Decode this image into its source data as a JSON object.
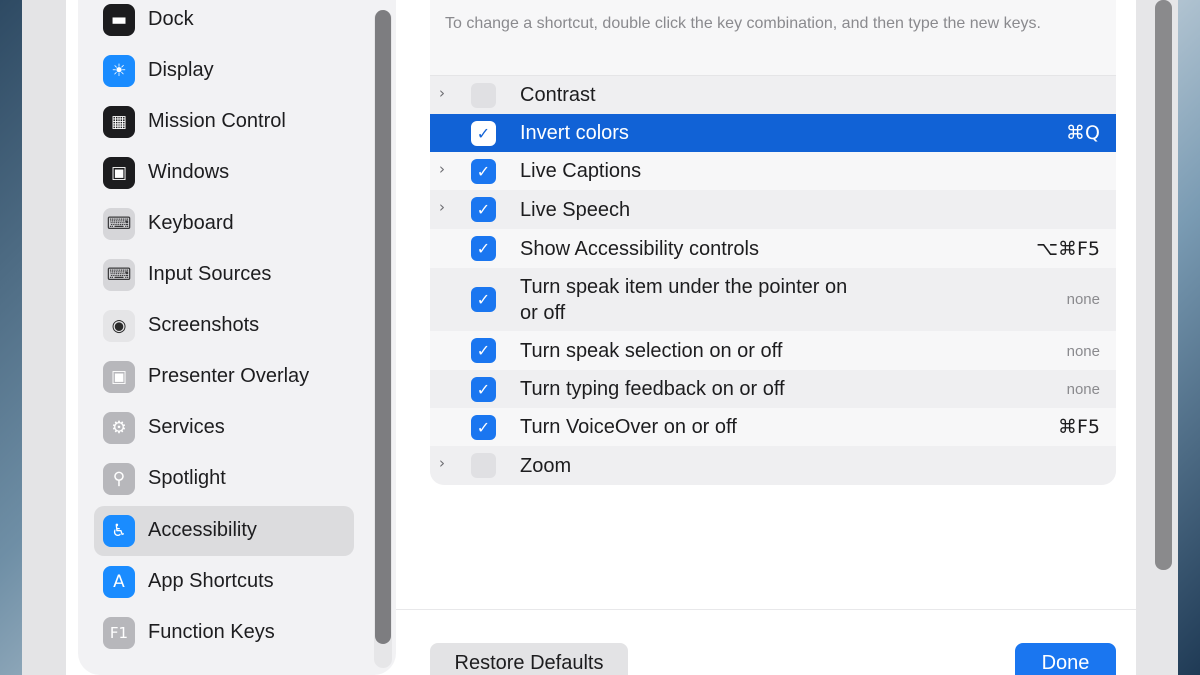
{
  "sidebar": {
    "items": [
      {
        "label": "Dock",
        "icon": "dock-icon",
        "glyph": "▬"
      },
      {
        "label": "Display",
        "icon": "sun-icon",
        "glyph": "☀"
      },
      {
        "label": "Mission Control",
        "icon": "mission-control-icon",
        "glyph": "▦"
      },
      {
        "label": "Windows",
        "icon": "windows-icon",
        "glyph": "▣"
      },
      {
        "label": "Keyboard",
        "icon": "keyboard-icon",
        "glyph": "⌨"
      },
      {
        "label": "Input Sources",
        "icon": "input-sources-icon",
        "glyph": "⌨"
      },
      {
        "label": "Screenshots",
        "icon": "camera-icon",
        "glyph": "◉"
      },
      {
        "label": "Presenter Overlay",
        "icon": "presenter-overlay-icon",
        "glyph": "▣"
      },
      {
        "label": "Services",
        "icon": "gears-icon",
        "glyph": "⚙"
      },
      {
        "label": "Spotlight",
        "icon": "magnifier-icon",
        "glyph": "⚲"
      },
      {
        "label": "Accessibility",
        "icon": "accessibility-icon",
        "glyph": "♿"
      },
      {
        "label": "App Shortcuts",
        "icon": "app-store-icon",
        "glyph": "A"
      },
      {
        "label": "Function Keys",
        "icon": "function-keys-icon",
        "glyph": "F1"
      }
    ],
    "selected": "Accessibility"
  },
  "main": {
    "description": "To change a shortcut, double click the key combination, and then type the new keys.",
    "rows": [
      {
        "label": "Contrast",
        "expandable": true,
        "checked": false,
        "key": ""
      },
      {
        "label": "Invert colors",
        "expandable": false,
        "checked": true,
        "key": "⌘Q",
        "selected": true
      },
      {
        "label": "Live Captions",
        "expandable": true,
        "checked": true,
        "key": ""
      },
      {
        "label": "Live Speech",
        "expandable": true,
        "checked": true,
        "key": ""
      },
      {
        "label": "Show Accessibility controls",
        "expandable": false,
        "checked": true,
        "key": "⌥⌘F5"
      },
      {
        "label": "Turn speak item under the pointer on or off",
        "label_line1": "Turn speak item under the pointer on",
        "label_line2": "or off",
        "expandable": false,
        "checked": true,
        "key": "none"
      },
      {
        "label": "Turn speak selection on or off",
        "expandable": false,
        "checked": true,
        "key": "none"
      },
      {
        "label": "Turn typing feedback on or off",
        "expandable": false,
        "checked": true,
        "key": "none"
      },
      {
        "label": "Turn VoiceOver on or off",
        "expandable": false,
        "checked": true,
        "key": "⌘F5"
      },
      {
        "label": "Zoom",
        "expandable": true,
        "checked": false,
        "key": ""
      }
    ],
    "chevron_glyph": "›",
    "check_glyph": "✓"
  },
  "footer": {
    "restore_label": "Restore Defaults",
    "done_label": "Done"
  },
  "colors": {
    "accent": "#1a76f0",
    "selected_row": "#1162d6"
  }
}
